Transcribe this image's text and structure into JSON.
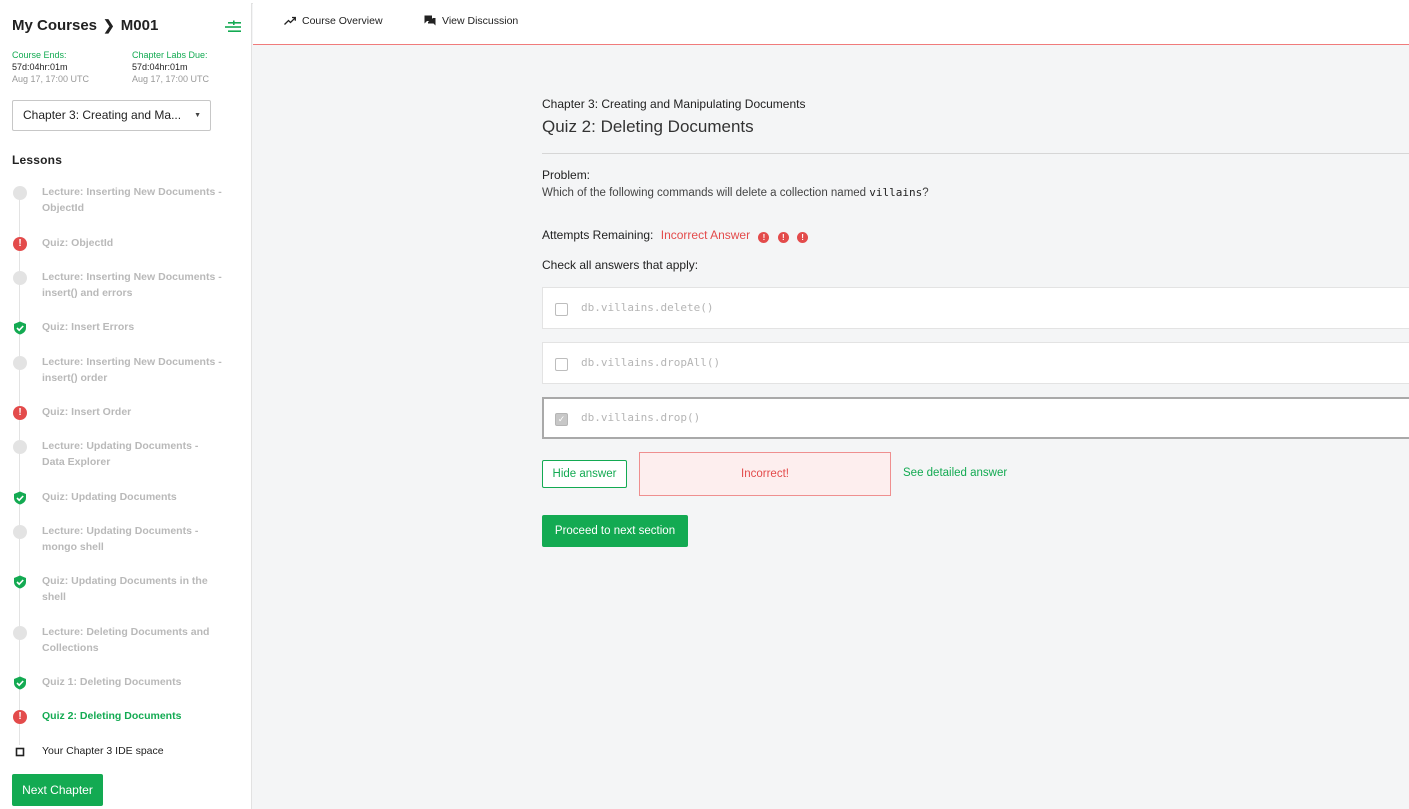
{
  "breadcrumb": {
    "root": "My Courses",
    "course": "M001"
  },
  "deadlines": {
    "course_label": "Course Ends:",
    "course_countdown": "57d:04hr:01m",
    "course_date": "Aug 17, 17:00 UTC",
    "labs_label": "Chapter Labs Due:",
    "labs_countdown": "57d:04hr:01m",
    "labs_date": "Aug 17, 17:00 UTC"
  },
  "chapter_select": {
    "value": "Chapter 3: Creating and Ma..."
  },
  "lessons_title": "Lessons",
  "lessons": [
    {
      "label": "Lecture: Inserting New Documents - ObjectId",
      "status": "lecture"
    },
    {
      "label": "Quiz: ObjectId",
      "status": "incorrect"
    },
    {
      "label": "Lecture: Inserting New Documents - insert() and errors",
      "status": "lecture"
    },
    {
      "label": "Quiz: Insert Errors",
      "status": "correct"
    },
    {
      "label": "Lecture: Inserting New Documents - insert() order",
      "status": "lecture"
    },
    {
      "label": "Quiz: Insert Order",
      "status": "incorrect"
    },
    {
      "label": "Lecture: Updating Documents - Data Explorer",
      "status": "lecture"
    },
    {
      "label": "Quiz: Updating Documents",
      "status": "correct"
    },
    {
      "label": "Lecture: Updating Documents - mongo shell",
      "status": "lecture"
    },
    {
      "label": "Quiz: Updating Documents in the shell",
      "status": "correct"
    },
    {
      "label": "Lecture: Deleting Documents and Collections",
      "status": "lecture"
    },
    {
      "label": "Quiz 1: Deleting Documents",
      "status": "correct"
    },
    {
      "label": "Quiz 2: Deleting Documents",
      "status": "incorrect",
      "active": true
    },
    {
      "label": "Your Chapter 3 IDE space",
      "status": "ide"
    }
  ],
  "next_chapter_label": "Next Chapter",
  "nav": {
    "overview": "Course Overview",
    "discussion": "View Discussion"
  },
  "main": {
    "chapter": "Chapter 3: Creating and Manipulating Documents",
    "title": "Quiz 2: Deleting Documents",
    "problem_label": "Problem:",
    "problem_text_before": "Which of the following commands will delete a collection named ",
    "problem_code": "villains",
    "problem_text_after": "?",
    "attempts_label": "Attempts Remaining:",
    "attempts_status": "Incorrect Answer",
    "check_all": "Check all answers that apply:",
    "answers": [
      {
        "code": "db.villains.delete()",
        "checked": false
      },
      {
        "code": "db.villains.dropAll()",
        "checked": false
      },
      {
        "code": "db.villains.drop()",
        "checked": true
      }
    ],
    "hide_answer": "Hide answer",
    "result": "Incorrect!",
    "detailed_link": "See detailed answer",
    "proceed": "Proceed to next section"
  },
  "colors": {
    "accent": "#13aa52",
    "error": "#e34b4b"
  }
}
